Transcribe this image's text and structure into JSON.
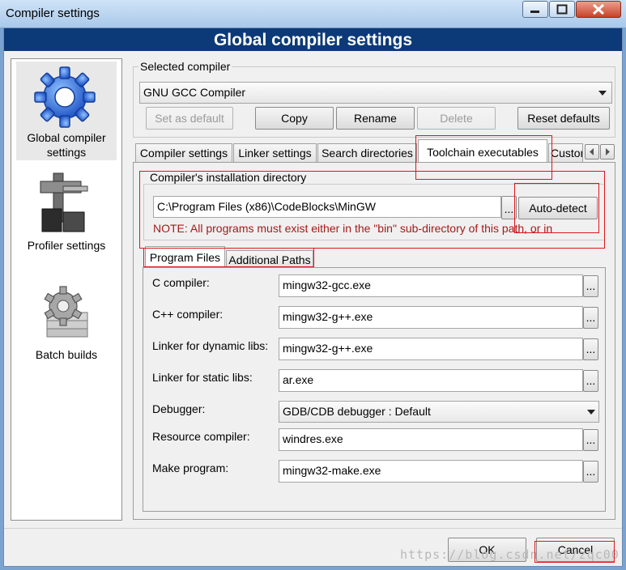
{
  "window": {
    "title": "Compiler settings",
    "controls": {
      "minimize": "minimize-icon",
      "maximize": "maximize-icon",
      "close": "close-icon"
    }
  },
  "header": {
    "title": "Global compiler settings",
    "background": "#0c3a78"
  },
  "sidebar": {
    "items": [
      {
        "label": "Global compiler\nsettings",
        "icon": "gear-icon",
        "selected": true
      },
      {
        "label": "Profiler settings",
        "icon": "caliper-icon"
      },
      {
        "label": "Batch builds",
        "icon": "batch-gear-icon"
      }
    ]
  },
  "compiler": {
    "group_label": "Selected compiler",
    "selected": "GNU GCC Compiler",
    "buttons": {
      "set_default": "Set as default",
      "copy": "Copy",
      "rename": "Rename",
      "delete": "Delete",
      "reset": "Reset defaults"
    }
  },
  "tabs": [
    {
      "label": "Compiler settings"
    },
    {
      "label": "Linker settings"
    },
    {
      "label": "Search directories"
    },
    {
      "label": "Toolchain executables",
      "active": true
    },
    {
      "label": "Custor"
    }
  ],
  "install": {
    "group_label": "Compiler's installation directory",
    "path": "C:\\Program Files (x86)\\CodeBlocks\\MinGW",
    "browse": "...",
    "autodetect": "Auto-detect",
    "note": "NOTE: All programs must exist either in the \"bin\" sub-directory of this path, or in",
    "note_color": "#a51a1a"
  },
  "subtabs": [
    {
      "label": "Program Files",
      "active": true
    },
    {
      "label": "Additional Paths"
    }
  ],
  "programs": [
    {
      "label": "C compiler:",
      "value": "mingw32-gcc.exe"
    },
    {
      "label": "C++ compiler:",
      "value": "mingw32-g++.exe"
    },
    {
      "label": "Linker for dynamic libs:",
      "value": "mingw32-g++.exe"
    },
    {
      "label": "Linker for static libs:",
      "value": "ar.exe"
    },
    {
      "label": "Debugger:",
      "value": "GDB/CDB debugger : Default",
      "type": "dropdown"
    },
    {
      "label": "Resource compiler:",
      "value": "windres.exe"
    },
    {
      "label": "Make program:",
      "value": "mingw32-make.exe"
    }
  ],
  "footer": {
    "ok": "OK",
    "cancel": "Cancel",
    "watermark": "https://blog.csdn.net/zqc00"
  },
  "highlight_color": "#e0151b"
}
